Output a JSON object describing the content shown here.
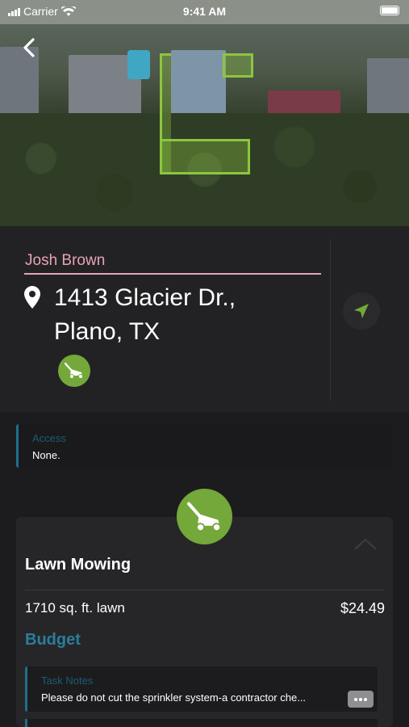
{
  "status_bar": {
    "carrier": "Carrier",
    "time": "9:41 AM",
    "signal_icon": "signal-bars-icon",
    "wifi_icon": "wifi-icon",
    "battery_icon": "battery-icon"
  },
  "header": {
    "back_icon": "chevron-left-icon"
  },
  "customer": {
    "name": "Josh Brown",
    "address_line1": "1413 Glacier Dr.,",
    "address_line2": "Plano, TX",
    "pin_icon": "map-pin-icon",
    "navigate_icon": "navigation-arrow-icon",
    "service_icon": "lawn-mower-icon"
  },
  "access": {
    "label": "Access",
    "value": "None."
  },
  "task": {
    "icon": "lawn-mower-icon",
    "title": "Lawn Mowing",
    "collapse_icon": "chevron-up-icon",
    "lawn_size": "1710 sq. ft. lawn",
    "price": "$24.49",
    "budget_label": "Budget",
    "notes_label": "Task Notes",
    "notes_value": "Please do not cut the sprinkler system-a contractor che...",
    "more_icon": "ellipsis-icon"
  },
  "colors": {
    "accent_green": "#74a83a",
    "name_pink": "#e8a3b6",
    "label_blue": "#1f6f8b",
    "budget_blue": "#2a7e9b",
    "background": "#1c1c1e"
  }
}
